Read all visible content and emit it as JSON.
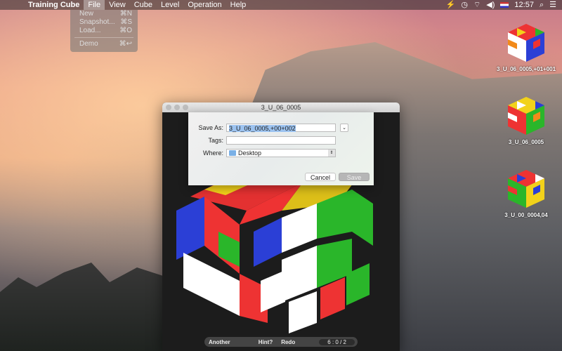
{
  "menubar": {
    "apple_icon": "apple-icon",
    "app_name": "Training Cube",
    "menus": [
      "File",
      "View",
      "Cube",
      "Level",
      "Operation",
      "Help"
    ],
    "clock": "12:57",
    "status_icons": [
      "battery-icon",
      "time-machine-icon",
      "wifi-icon",
      "volume-icon",
      "flag-icon",
      "search-icon",
      "list-icon"
    ]
  },
  "file_menu": {
    "items": [
      {
        "label": "New",
        "shortcut": "⌘N"
      },
      {
        "label": "Snapshot...",
        "shortcut": "⌘S"
      },
      {
        "label": "Load...",
        "shortcut": "⌘O"
      },
      {
        "label": "Demo",
        "shortcut": "⌘↩"
      }
    ]
  },
  "desktop_icons": [
    {
      "label": "3_U_06_0005,+01+001"
    },
    {
      "label": "3_U_06_0005"
    },
    {
      "label": "3_U_00_0004,04"
    }
  ],
  "window": {
    "title": "3_U_06_0005",
    "buttons": {
      "another": "Another",
      "hint": "Hint?",
      "redo": "Redo",
      "counter": "6 : 0 / 2"
    }
  },
  "save_sheet": {
    "save_as_label": "Save As:",
    "save_as_value": "3_U_06_0005,+00+002",
    "tags_label": "Tags:",
    "tags_value": "",
    "where_label": "Where:",
    "where_value": "Desktop",
    "cancel_label": "Cancel",
    "save_label": "Save"
  }
}
